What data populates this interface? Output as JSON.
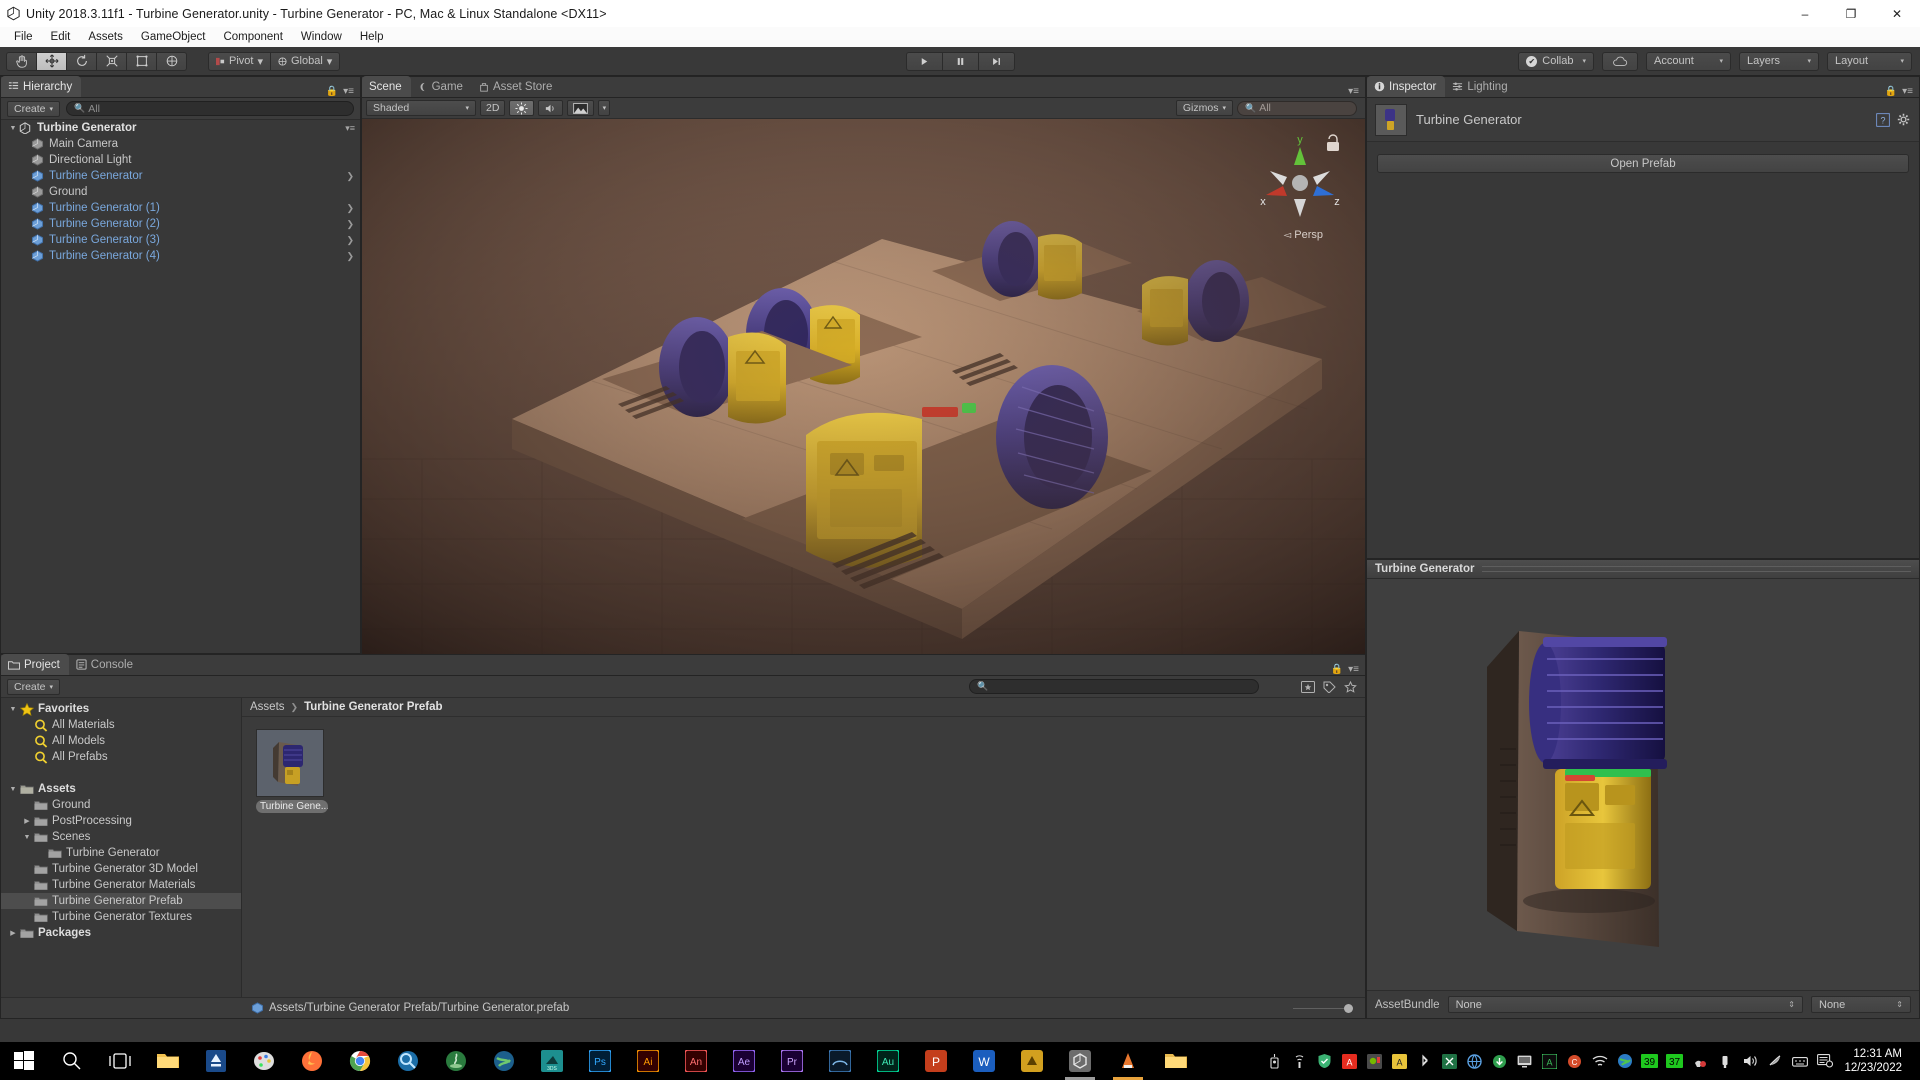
{
  "window": {
    "title": "Unity 2018.3.11f1 - Turbine Generator.unity - Turbine Generator - PC, Mac & Linux Standalone <DX11>",
    "minimize": "–",
    "maximize": "❐",
    "close": "✕"
  },
  "menubar": {
    "items": [
      "File",
      "Edit",
      "Assets",
      "GameObject",
      "Component",
      "Window",
      "Help"
    ]
  },
  "toolbar": {
    "tools": [
      "hand-tool",
      "move-tool",
      "rotate-tool",
      "scale-tool",
      "rect-tool",
      "transform-tool"
    ],
    "pivot_label": "Pivot",
    "global_label": "Global",
    "play_label": "play-button",
    "pause_label": "pause-button",
    "step_label": "step-button",
    "collab_label": "Collab",
    "cloud_label": "cloud-button",
    "account_label": "Account",
    "layers_label": "Layers",
    "layout_label": "Layout"
  },
  "hierarchy": {
    "tab": "Hierarchy",
    "create_label": "Create",
    "search_placeholder": "All",
    "root": {
      "label": "Turbine Generator"
    },
    "items": [
      {
        "label": "Main Camera",
        "kind": "gameobject",
        "expandable": false
      },
      {
        "label": "Directional Light",
        "kind": "gameobject",
        "expandable": false
      },
      {
        "label": "Turbine Generator",
        "kind": "prefab",
        "expandable": true
      },
      {
        "label": "Ground",
        "kind": "gameobject",
        "expandable": false
      },
      {
        "label": "Turbine Generator (1)",
        "kind": "prefab",
        "expandable": true
      },
      {
        "label": "Turbine Generator (2)",
        "kind": "prefab",
        "expandable": true
      },
      {
        "label": "Turbine Generator (3)",
        "kind": "prefab",
        "expandable": true
      },
      {
        "label": "Turbine Generator (4)",
        "kind": "prefab",
        "expandable": true
      }
    ]
  },
  "scene": {
    "tabs": [
      {
        "label": "Scene",
        "active": true
      },
      {
        "label": "Game",
        "active": false
      },
      {
        "label": "Asset Store",
        "active": false
      }
    ],
    "draw_mode": "Shaded",
    "twod_label": "2D",
    "lighting_label": "lighting-toggle",
    "audio_label": "audio-toggle",
    "effects_label": "effects-toggle",
    "gizmos_label": "Gizmos",
    "search_placeholder": "All",
    "axis_x": "x",
    "axis_y": "y",
    "axis_z": "z",
    "persp_label": "Persp"
  },
  "inspector": {
    "tabs": [
      {
        "label": "Inspector",
        "active": true
      },
      {
        "label": "Lighting",
        "active": false
      }
    ],
    "object_name": "Turbine Generator",
    "open_prefab_label": "Open Prefab"
  },
  "preview": {
    "title": "Turbine Generator",
    "assetbundle_label": "AssetBundle",
    "assetbundle_value": "None",
    "variant_value": "None"
  },
  "project": {
    "tabs": [
      {
        "label": "Project",
        "active": true
      },
      {
        "label": "Console",
        "active": false
      }
    ],
    "create_label": "Create",
    "search_placeholder": "",
    "breadcrumb": [
      "Assets",
      "Turbine Generator Prefab"
    ],
    "tree": [
      {
        "label": "Favorites",
        "indent": 0,
        "arrow": "down",
        "icon": "star",
        "bold": true
      },
      {
        "label": "All Materials",
        "indent": 1,
        "arrow": "",
        "icon": "search",
        "bold": false
      },
      {
        "label": "All Models",
        "indent": 1,
        "arrow": "",
        "icon": "search",
        "bold": false
      },
      {
        "label": "All Prefabs",
        "indent": 1,
        "arrow": "",
        "icon": "search",
        "bold": false
      },
      {
        "label": "",
        "indent": 0,
        "arrow": "",
        "icon": "none",
        "bold": false
      },
      {
        "label": "Assets",
        "indent": 0,
        "arrow": "down",
        "icon": "folder-open",
        "bold": true
      },
      {
        "label": "Ground",
        "indent": 1,
        "arrow": "",
        "icon": "folder",
        "bold": false
      },
      {
        "label": "PostProcessing",
        "indent": 1,
        "arrow": "right",
        "icon": "folder",
        "bold": false
      },
      {
        "label": "Scenes",
        "indent": 1,
        "arrow": "down",
        "icon": "folder",
        "bold": false
      },
      {
        "label": "Turbine Generator",
        "indent": 2,
        "arrow": "",
        "icon": "folder",
        "bold": false
      },
      {
        "label": "Turbine Generator 3D Model",
        "indent": 1,
        "arrow": "",
        "icon": "folder",
        "bold": false
      },
      {
        "label": "Turbine Generator Materials",
        "indent": 1,
        "arrow": "",
        "icon": "folder",
        "bold": false
      },
      {
        "label": "Turbine Generator Prefab",
        "indent": 1,
        "arrow": "",
        "icon": "folder",
        "bold": false,
        "selected": true
      },
      {
        "label": "Turbine Generator Textures",
        "indent": 1,
        "arrow": "",
        "icon": "folder",
        "bold": false
      },
      {
        "label": "Packages",
        "indent": 0,
        "arrow": "right",
        "icon": "folder",
        "bold": true
      }
    ],
    "assets": [
      {
        "label": "Turbine Gene..."
      }
    ],
    "status_path": "Assets/Turbine Generator Prefab/Turbine Generator.prefab"
  },
  "taskbar": {
    "start_label": "start-button",
    "apps": [
      "windows-start-icon",
      "search-icon",
      "task-view-icon",
      "file-explorer-icon",
      "scanner-icon",
      "paint-icon",
      "firefox-icon",
      "chrome-icon",
      "magnifier-icon",
      "java-icon",
      "globe-icon",
      "blender-icon",
      "photoshop-icon",
      "illustrator-icon",
      "animate-icon",
      "after-effects-icon",
      "premiere-icon",
      "bridge-icon",
      "audition-icon",
      "powerpoint-icon",
      "word-icon",
      "substance-icon",
      "unity-icon",
      "vlc-icon",
      "folder-icon"
    ],
    "tray": [
      "battery-icon",
      "hid-icon",
      "defender-icon",
      "adobe-icon",
      "nvidia-icon",
      "autodesk-icon",
      "bluetooth-icon",
      "excel-icon",
      "globe2-icon",
      "download-icon",
      "monitor-icon",
      "acrobat-icon",
      "cc-icon",
      "wifi-icon",
      "earth-icon",
      "39-badge",
      "37-badge",
      "app-icon",
      "usb-icon",
      "volume-icon",
      "mute-icon",
      "keyboard-icon",
      "notification-icon"
    ],
    "badge1": "39",
    "badge2": "37",
    "time": "12:31 AM",
    "date": "12/23/2022"
  },
  "colors": {
    "panel_bg": "#383838",
    "panel_header": "#3c3c3c",
    "prefab_blue": "#7aa8dd",
    "selection": "#4d4d4d",
    "accent_yellow": "#e3c53a"
  }
}
